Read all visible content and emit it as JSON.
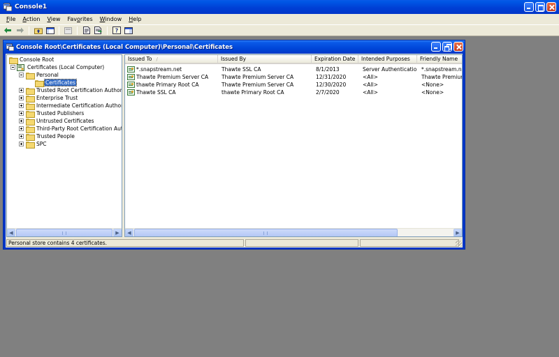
{
  "app": {
    "title": "Console1"
  },
  "menu": [
    {
      "pre": "",
      "ul": "F",
      "post": "ile"
    },
    {
      "pre": "",
      "ul": "A",
      "post": "ction"
    },
    {
      "pre": "",
      "ul": "V",
      "post": "iew"
    },
    {
      "pre": "Fav",
      "ul": "o",
      "post": "rites"
    },
    {
      "pre": "",
      "ul": "W",
      "post": "indow"
    },
    {
      "pre": "",
      "ul": "H",
      "post": "elp"
    }
  ],
  "toolbar": {
    "icons": [
      "back-arrow-icon",
      "forward-arrow-icon",
      "up-folder-icon",
      "show-hide-tree-icon",
      "delete-icon",
      "properties-icon",
      "export-list-icon",
      "help-icon",
      "action-pane-icon"
    ]
  },
  "child_window": {
    "title": "Console Root\\Certificates (Local Computer)\\Personal\\Certificates"
  },
  "tree": {
    "root": "Console Root",
    "certs": "Certificates (Local Computer)",
    "personal": "Personal",
    "selected": "Certificates",
    "stores": [
      "Trusted Root Certification Authorities",
      "Enterprise Trust",
      "Intermediate Certification Authorities",
      "Trusted Publishers",
      "Untrusted Certificates",
      "Third-Party Root Certification Authorities",
      "Trusted People",
      "SPC"
    ]
  },
  "list": {
    "columns": [
      "Issued To",
      "Issued By",
      "Expiration Date",
      "Intended Purposes",
      "Friendly Name"
    ],
    "sort_indicator": "/",
    "rows": [
      [
        "*.snapstream.net",
        "Thawte SSL CA",
        "8/1/2013",
        "Server Authenticatio...",
        "*.snapstream.net"
      ],
      [
        "Thawte Premium Server CA",
        "Thawte Premium Server CA",
        "12/31/2020",
        "<All>",
        "Thawte Premium Ser"
      ],
      [
        "thawte Primary Root CA",
        "Thawte Premium Server CA",
        "12/30/2020",
        "<All>",
        "<None>"
      ],
      [
        "Thawte SSL CA",
        "thawte Primary Root CA",
        "2/7/2020",
        "<All>",
        "<None>"
      ]
    ]
  },
  "status": {
    "text": "Personal store contains 4 certificates."
  },
  "colors": {
    "titlebar": "#0046d8",
    "selection": "#316ac5",
    "workspace": "#808080",
    "chrome": "#ece9d8"
  }
}
